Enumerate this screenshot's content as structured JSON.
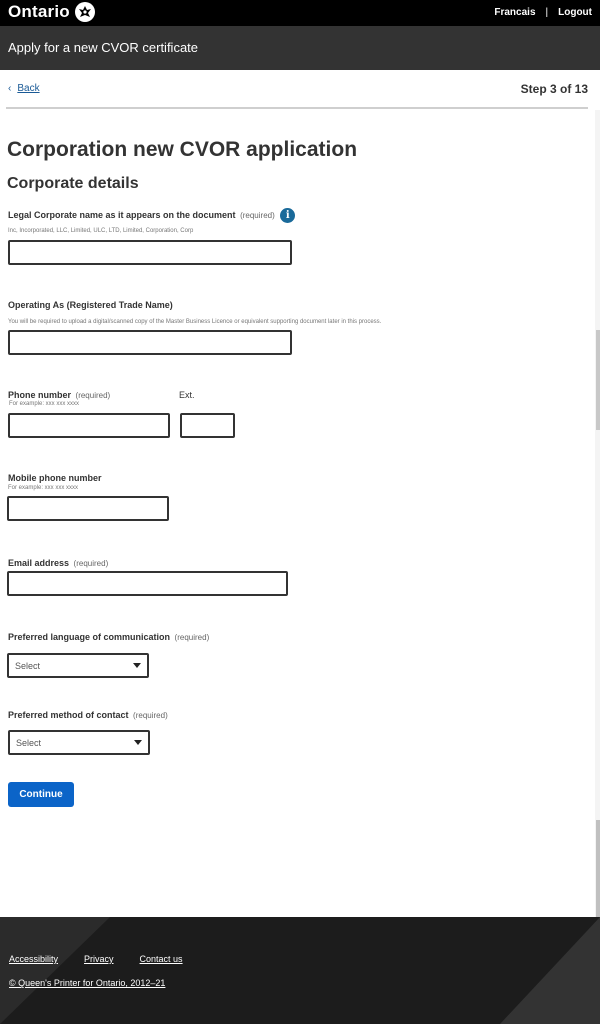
{
  "header": {
    "brand": "Ontario",
    "links": [
      {
        "label": "Francais"
      },
      {
        "label": "Logout"
      }
    ],
    "separator": "|",
    "app_title": "Apply for a new CVOR certificate"
  },
  "nav": {
    "back_label": "Back",
    "back_icon": "chevron-left-icon",
    "step": "Step 3 of 13"
  },
  "page": {
    "title": "Corporation new CVOR application",
    "section": "Corporate details"
  },
  "form": {
    "required_text": "(required)",
    "legal_name": {
      "label": "Legal Corporate name as it appears on the document",
      "hint": "Inc, Incorporated, LLC, Limited, ULC, LTD, Limited, Corporation, Corp",
      "value": "",
      "info_icon": "i"
    },
    "operating_as": {
      "label": "Operating As (Registered Trade Name)",
      "hint": "You will be required to upload a digital/scanned copy of the Master Business Licence or equivalent supporting document later in this process.",
      "value": ""
    },
    "phone": {
      "label": "Phone number",
      "hint": "For example: xxx xxx xxxx",
      "value": ""
    },
    "ext": {
      "label": "Ext.",
      "value": ""
    },
    "mobile": {
      "label": "Mobile phone number",
      "hint": "For example: xxx xxx xxxx",
      "value": ""
    },
    "email": {
      "label": "Email address",
      "value": ""
    },
    "language": {
      "label": "Preferred language of communication",
      "selected": "Select"
    },
    "contact_method": {
      "label": "Preferred method of contact",
      "selected": "Select"
    },
    "continue_label": "Continue"
  },
  "footer": {
    "links": [
      {
        "label": "Accessibility"
      },
      {
        "label": "Privacy"
      },
      {
        "label": "Contact us"
      }
    ],
    "copyright": "© Queen's Printer for Ontario, 2012–21"
  }
}
